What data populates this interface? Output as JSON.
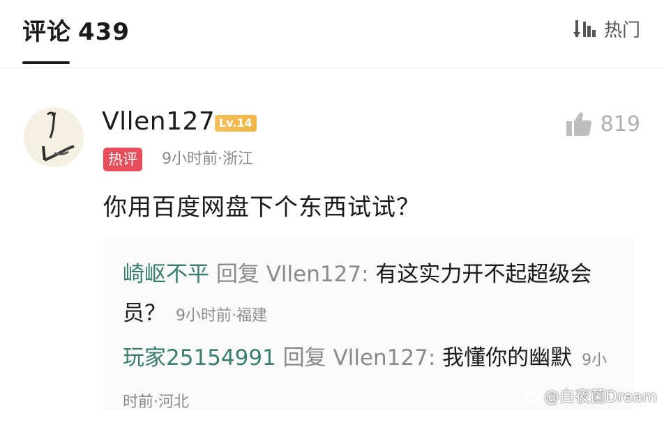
{
  "header": {
    "title": "评论",
    "count": "439",
    "sort_label": "热门"
  },
  "comment": {
    "username": "Vllen127",
    "level": "Lv.14",
    "hot_badge": "热评",
    "meta": "9小时前·浙江",
    "likes": "819",
    "text": "你用百度网盘下个东西试试？"
  },
  "replies": [
    {
      "author": "崎岖不平",
      "reply_word": "回复",
      "target": "Vllen127:",
      "text": "有这实力开不起超级会员？",
      "time": "9小时前·福建"
    },
    {
      "author": "玩家25154991",
      "reply_word": "回复",
      "target": "Vllen127:",
      "text": "我懂你的幽默",
      "time": "9小时前·河北"
    }
  ],
  "watermark": "@白夜菌Dream"
}
